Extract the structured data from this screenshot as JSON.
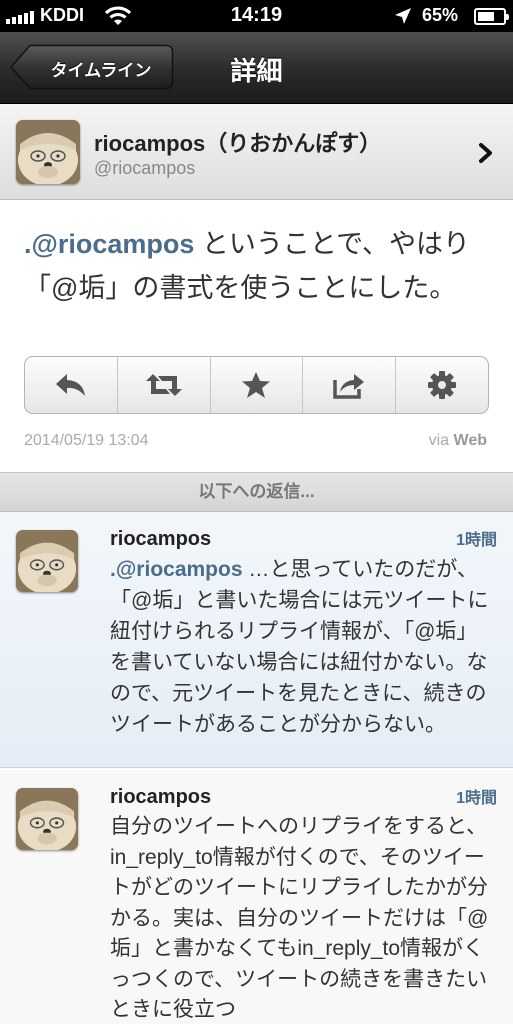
{
  "status_bar": {
    "carrier": "KDDI",
    "time": "14:19",
    "battery_percent": "65%",
    "battery_level": 0.65,
    "signal_bars": 5
  },
  "nav": {
    "back_label": "タイムライン",
    "title": "詳細"
  },
  "profile": {
    "display_name": "riocampos（りおかんぽす）",
    "handle": "@riocampos"
  },
  "tweet": {
    "mention": ".@riocampos",
    "text": " ということで、やはり「@垢」の書式を使うことにした。",
    "timestamp": "2014/05/19 13:04",
    "via_prefix": "via ",
    "via_source": "Web",
    "actions": [
      "reply-icon",
      "retweet-icon",
      "favorite-icon",
      "share-icon",
      "settings-icon"
    ]
  },
  "replies_header": "以下への返信...",
  "replies": [
    {
      "name": "riocampos",
      "time": "1時間",
      "mention": ".@riocampos",
      "text": " …と思っていたのだが、「@垢」と書いた場合には元ツイートに紐付けられるリプライ情報が、「@垢」を書いていない場合には紐付かない。なので、元ツイートを見たときに、続きのツイートがあることが分からない。"
    },
    {
      "name": "riocampos",
      "time": "1時間",
      "mention": "",
      "text": "自分のツイートへのリプライをすると、in_reply_to情報が付くので、そのツイートがどのツイートにリプライしたかが分かる。実は、自分のツイートだけは「@垢」と書かなくてもin_reply_to情報がくっつくので、ツイートの続きを書きたいときに役立つ"
    }
  ],
  "colors": {
    "link": "#4a6d8c",
    "highlight_row": "#e9f0f7",
    "navbar": "#2a2a2a"
  }
}
